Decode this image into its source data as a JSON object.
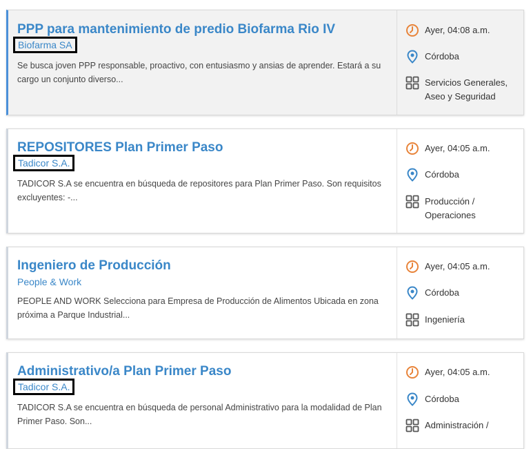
{
  "listings": [
    {
      "title": "PPP para mantenimiento de predio Biofarma Rio IV",
      "company": "Biofarma SA",
      "description": "Se busca joven PPP responsable, proactivo, con entusiasmo y ansias de aprender. Estará a su cargo un conjunto diverso...",
      "date": "Ayer, 04:08 a.m.",
      "location": "Córdoba",
      "category": "Servicios Generales, Aseo y Seguridad"
    },
    {
      "title": "REPOSITORES Plan Primer Paso",
      "company": "Tadicor S.A.",
      "description": "TADICOR S.A se encuentra en búsqueda de repositores para Plan Primer Paso. Son requisitos excluyentes: -...",
      "date": "Ayer, 04:05 a.m.",
      "location": "Córdoba",
      "category": "Producción / Operaciones"
    },
    {
      "title": "Ingeniero de Producción",
      "company": "People & Work",
      "description": "PEOPLE AND WORK Selecciona para Empresa de Producción de Alimentos Ubicada en zona próxima a Parque Industrial...",
      "date": "Ayer, 04:05 a.m.",
      "location": "Córdoba",
      "category": "Ingeniería"
    },
    {
      "title": "Administrativo/a Plan Primer Paso",
      "company": "Tadicor S.A.",
      "description": "TADICOR S.A se encuentra en búsqueda de personal Administrativo para la modalidad de Plan Primer Paso. Son...",
      "date": "Ayer, 04:05 a.m.",
      "location": "Córdoba",
      "category": "Administración /"
    }
  ],
  "icons": {
    "date": "clock-icon",
    "location": "location-pin-icon",
    "category": "grid-icon"
  },
  "colors": {
    "accent": "#3a87c8",
    "clock": "#e8843a",
    "pin": "#3a87c8",
    "grid": "#555555"
  }
}
